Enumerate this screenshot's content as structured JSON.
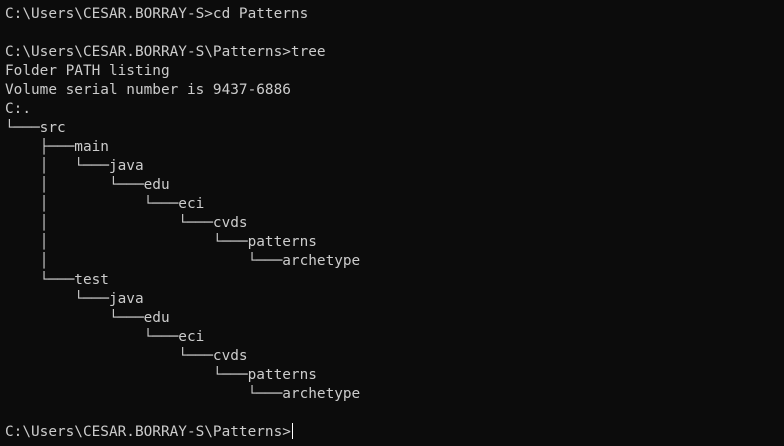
{
  "terminal": {
    "lines": [
      "C:\\Users\\CESAR.BORRAY-S>cd Patterns",
      "",
      "C:\\Users\\CESAR.BORRAY-S\\Patterns>tree",
      "Folder PATH listing",
      "Volume serial number is 9437-6886",
      "C:.",
      "└───src",
      "    ├───main",
      "    │   └───java",
      "    │       └───edu",
      "    │           └───eci",
      "    │               └───cvds",
      "    │                   └───patterns",
      "    │                       └───archetype",
      "    └───test",
      "        └───java",
      "            └───edu",
      "                └───eci",
      "                    └───cvds",
      "                        └───patterns",
      "                            └───archetype",
      "",
      "C:\\Users\\CESAR.BORRAY-S\\Patterns>"
    ],
    "colors": {
      "background": "#0c0c0c",
      "foreground": "#cccccc",
      "cursor": "#ffffff"
    }
  }
}
